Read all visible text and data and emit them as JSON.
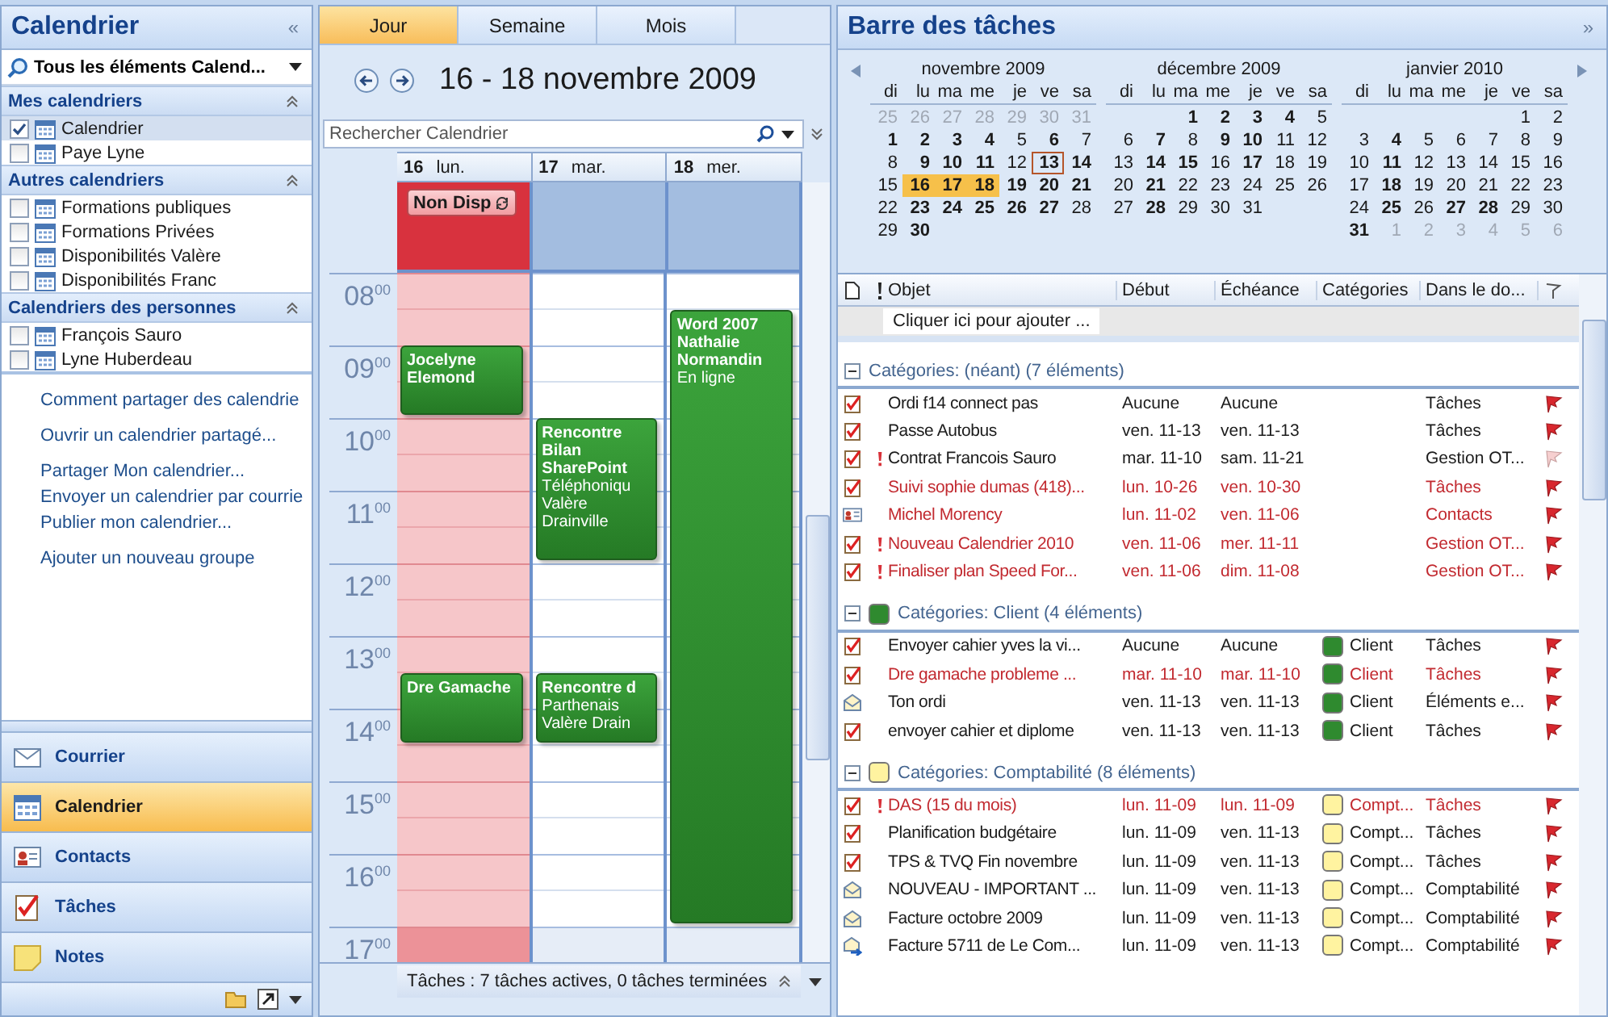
{
  "nav_pane": {
    "title": "Calendrier",
    "collapse": "«",
    "view_selector": "Tous les éléments Calend...",
    "groups": [
      {
        "title": "Mes calendriers",
        "items": [
          {
            "label": "Calendrier",
            "checked": true,
            "selected": true
          },
          {
            "label": "Paye Lyne",
            "checked": false,
            "selected": false
          }
        ]
      },
      {
        "title": "Autres calendriers",
        "items": [
          {
            "label": "Formations publiques",
            "checked": false,
            "selected": false
          },
          {
            "label": "Formations Privées",
            "checked": false,
            "selected": false
          },
          {
            "label": "Disponibilités Valère",
            "checked": false,
            "selected": false
          },
          {
            "label": "Disponibilités Franc",
            "checked": false,
            "selected": false
          }
        ]
      },
      {
        "title": "Calendriers des personnes",
        "items": [
          {
            "label": "François Sauro",
            "checked": false,
            "selected": false
          },
          {
            "label": "Lyne Huberdeau",
            "checked": false,
            "selected": false
          }
        ]
      }
    ],
    "link_groups": [
      [
        "Comment partager des calendrie"
      ],
      [
        "Ouvrir un calendrier partagé..."
      ],
      [
        "Partager Mon calendrier...",
        "Envoyer un calendrier par courrie",
        "Publier mon calendrier..."
      ],
      [
        "Ajouter un nouveau groupe"
      ]
    ],
    "buttons": [
      {
        "label": "Courrier",
        "kind": "mail",
        "selected": false
      },
      {
        "label": "Calendrier",
        "kind": "calendar",
        "selected": true
      },
      {
        "label": "Contacts",
        "kind": "contacts",
        "selected": false
      },
      {
        "label": "Tâches",
        "kind": "tasks",
        "selected": false
      },
      {
        "label": "Notes",
        "kind": "notes",
        "selected": false
      }
    ]
  },
  "calendar": {
    "tabs": [
      {
        "label": "Jour",
        "selected": true
      },
      {
        "label": "Semaine",
        "selected": false
      },
      {
        "label": "Mois",
        "selected": false
      }
    ],
    "date_range": "16 - 18 novembre 2009",
    "search": {
      "placeholder": "Rechercher Calendrier"
    },
    "hours": [
      {
        "h": "08",
        "m": "00"
      },
      {
        "h": "09",
        "m": "00"
      },
      {
        "h": "10",
        "m": "00"
      },
      {
        "h": "11",
        "m": "00"
      },
      {
        "h": "12",
        "m": "00"
      },
      {
        "h": "13",
        "m": "00"
      },
      {
        "h": "14",
        "m": "00"
      },
      {
        "h": "15",
        "m": "00"
      },
      {
        "h": "16",
        "m": "00"
      },
      {
        "h": "17",
        "m": "00"
      }
    ],
    "days": [
      {
        "number": "16",
        "weekday": "lun.",
        "unavailable": true,
        "all_day": [
          {
            "title": "Non Disp",
            "recurring": true
          }
        ],
        "events": [
          {
            "title": "Jocelyne Elemond"
          },
          {
            "title": "Dre Gamache"
          }
        ]
      },
      {
        "number": "17",
        "weekday": "mar.",
        "unavailable": false,
        "events": [
          {
            "title": "Rencontre Bilan SharePoint",
            "location": "Téléphoniqu Valère Drainville"
          },
          {
            "title": "Rencontre d",
            "location": "Parthenais Valère Drain"
          }
        ]
      },
      {
        "number": "18",
        "weekday": "mer.",
        "unavailable": false,
        "events": [
          {
            "title": "Word 2007 Nathalie Normandin",
            "location": "En ligne"
          }
        ]
      }
    ],
    "task_bar": "Tâches : 7 tâches actives, 0 tâches terminées"
  },
  "todo_bar": {
    "title": "Barre des tâches",
    "expand": "»",
    "months": [
      {
        "title": "novembre 2009",
        "weekdays": [
          "di",
          "lu",
          "ma",
          "me",
          "je",
          "ve",
          "sa"
        ],
        "weeks": [
          [
            {
              "n": "25",
              "kind": "muted",
              "selected": false
            },
            {
              "n": "26",
              "kind": "muted",
              "selected": false
            },
            {
              "n": "27",
              "kind": "muted",
              "selected": false
            },
            {
              "n": "28",
              "kind": "muted",
              "selected": false
            },
            {
              "n": "29",
              "kind": "muted",
              "selected": false
            },
            {
              "n": "30",
              "kind": "muted",
              "selected": false
            },
            {
              "n": "31",
              "kind": "muted",
              "selected": false
            }
          ],
          [
            {
              "n": "1",
              "kind": "bold",
              "selected": false
            },
            {
              "n": "2",
              "kind": "bold",
              "selected": false
            },
            {
              "n": "3",
              "kind": "bold",
              "selected": false
            },
            {
              "n": "4",
              "kind": "bold",
              "selected": false
            },
            {
              "n": "5",
              "kind": "plain",
              "selected": false
            },
            {
              "n": "6",
              "kind": "bold",
              "selected": false
            },
            {
              "n": "7",
              "kind": "plain",
              "selected": false
            }
          ],
          [
            {
              "n": "8",
              "kind": "plain",
              "selected": false
            },
            {
              "n": "9",
              "kind": "bold",
              "selected": false
            },
            {
              "n": "10",
              "kind": "bold",
              "selected": false
            },
            {
              "n": "11",
              "kind": "bold",
              "selected": false
            },
            {
              "n": "12",
              "kind": "plain",
              "selected": false
            },
            {
              "n": "13",
              "kind": "today",
              "selected": false
            },
            {
              "n": "14",
              "kind": "bold",
              "selected": false
            }
          ],
          [
            {
              "n": "15",
              "kind": "plain",
              "selected": false
            },
            {
              "n": "16",
              "kind": "bold",
              "selected": true
            },
            {
              "n": "17",
              "kind": "bold",
              "selected": true
            },
            {
              "n": "18",
              "kind": "bold",
              "selected": true
            },
            {
              "n": "19",
              "kind": "bold",
              "selected": false
            },
            {
              "n": "20",
              "kind": "bold",
              "selected": false
            },
            {
              "n": "21",
              "kind": "bold",
              "selected": false
            }
          ],
          [
            {
              "n": "22",
              "kind": "plain",
              "selected": false
            },
            {
              "n": "23",
              "kind": "bold",
              "selected": false
            },
            {
              "n": "24",
              "kind": "bold",
              "selected": false
            },
            {
              "n": "25",
              "kind": "bold",
              "selected": false
            },
            {
              "n": "26",
              "kind": "bold",
              "selected": false
            },
            {
              "n": "27",
              "kind": "bold",
              "selected": false
            },
            {
              "n": "28",
              "kind": "plain",
              "selected": false
            }
          ],
          [
            {
              "n": "29",
              "kind": "plain",
              "selected": false
            },
            {
              "n": "30",
              "kind": "bold",
              "selected": false
            },
            {
              "kind": "blank",
              "selected": false
            },
            {
              "kind": "blank",
              "selected": false
            },
            {
              "kind": "blank",
              "selected": false
            },
            {
              "kind": "blank",
              "selected": false
            },
            {
              "kind": "blank",
              "selected": false
            }
          ]
        ]
      },
      {
        "title": "décembre 2009",
        "weekdays": [
          "di",
          "lu",
          "ma",
          "me",
          "je",
          "ve",
          "sa"
        ],
        "weeks": [
          [
            {
              "kind": "blank",
              "selected": false
            },
            {
              "kind": "blank",
              "selected": false
            },
            {
              "n": "1",
              "kind": "bold",
              "selected": false
            },
            {
              "n": "2",
              "kind": "bold",
              "selected": false
            },
            {
              "n": "3",
              "kind": "bold",
              "selected": false
            },
            {
              "n": "4",
              "kind": "bold",
              "selected": false
            },
            {
              "n": "5",
              "kind": "plain",
              "selected": false
            }
          ],
          [
            {
              "n": "6",
              "kind": "plain",
              "selected": false
            },
            {
              "n": "7",
              "kind": "bold",
              "selected": false
            },
            {
              "n": "8",
              "kind": "plain",
              "selected": false
            },
            {
              "n": "9",
              "kind": "bold",
              "selected": false
            },
            {
              "n": "10",
              "kind": "bold",
              "selected": false
            },
            {
              "n": "11",
              "kind": "plain",
              "selected": false
            },
            {
              "n": "12",
              "kind": "plain",
              "selected": false
            }
          ],
          [
            {
              "n": "13",
              "kind": "plain",
              "selected": false
            },
            {
              "n": "14",
              "kind": "bold",
              "selected": false
            },
            {
              "n": "15",
              "kind": "bold",
              "selected": false
            },
            {
              "n": "16",
              "kind": "plain",
              "selected": false
            },
            {
              "n": "17",
              "kind": "bold",
              "selected": false
            },
            {
              "n": "18",
              "kind": "plain",
              "selected": false
            },
            {
              "n": "19",
              "kind": "plain",
              "selected": false
            }
          ],
          [
            {
              "n": "20",
              "kind": "plain",
              "selected": false
            },
            {
              "n": "21",
              "kind": "bold",
              "selected": false
            },
            {
              "n": "22",
              "kind": "plain",
              "selected": false
            },
            {
              "n": "23",
              "kind": "plain",
              "selected": false
            },
            {
              "n": "24",
              "kind": "plain",
              "selected": false
            },
            {
              "n": "25",
              "kind": "plain",
              "selected": false
            },
            {
              "n": "26",
              "kind": "plain",
              "selected": false
            }
          ],
          [
            {
              "n": "27",
              "kind": "plain",
              "selected": false
            },
            {
              "n": "28",
              "kind": "bold",
              "selected": false
            },
            {
              "n": "29",
              "kind": "plain",
              "selected": false
            },
            {
              "n": "30",
              "kind": "plain",
              "selected": false
            },
            {
              "n": "31",
              "kind": "plain",
              "selected": false
            },
            {
              "kind": "blank",
              "selected": false
            },
            {
              "kind": "blank",
              "selected": false
            }
          ]
        ]
      },
      {
        "title": "janvier 2010",
        "weekdays": [
          "di",
          "lu",
          "ma",
          "me",
          "je",
          "ve",
          "sa"
        ],
        "weeks": [
          [
            {
              "kind": "blank",
              "selected": false
            },
            {
              "kind": "blank",
              "selected": false
            },
            {
              "kind": "blank",
              "selected": false
            },
            {
              "kind": "blank",
              "selected": false
            },
            {
              "kind": "blank",
              "selected": false
            },
            {
              "n": "1",
              "kind": "plain",
              "selected": false
            },
            {
              "n": "2",
              "kind": "plain",
              "selected": false
            }
          ],
          [
            {
              "n": "3",
              "kind": "plain",
              "selected": false
            },
            {
              "n": "4",
              "kind": "bold",
              "selected": false
            },
            {
              "n": "5",
              "kind": "plain",
              "selected": false
            },
            {
              "n": "6",
              "kind": "plain",
              "selected": false
            },
            {
              "n": "7",
              "kind": "plain",
              "selected": false
            },
            {
              "n": "8",
              "kind": "plain",
              "selected": false
            },
            {
              "n": "9",
              "kind": "plain",
              "selected": false
            }
          ],
          [
            {
              "n": "10",
              "kind": "plain",
              "selected": false
            },
            {
              "n": "11",
              "kind": "bold",
              "selected": false
            },
            {
              "n": "12",
              "kind": "plain",
              "selected": false
            },
            {
              "n": "13",
              "kind": "plain",
              "selected": false
            },
            {
              "n": "14",
              "kind": "plain",
              "selected": false
            },
            {
              "n": "15",
              "kind": "plain",
              "selected": false
            },
            {
              "n": "16",
              "kind": "plain",
              "selected": false
            }
          ],
          [
            {
              "n": "17",
              "kind": "plain",
              "selected": false
            },
            {
              "n": "18",
              "kind": "bold",
              "selected": false
            },
            {
              "n": "19",
              "kind": "plain",
              "selected": false
            },
            {
              "n": "20",
              "kind": "plain",
              "selected": false
            },
            {
              "n": "21",
              "kind": "plain",
              "selected": false
            },
            {
              "n": "22",
              "kind": "plain",
              "selected": false
            },
            {
              "n": "23",
              "kind": "plain",
              "selected": false
            }
          ],
          [
            {
              "n": "24",
              "kind": "plain",
              "selected": false
            },
            {
              "n": "25",
              "kind": "bold",
              "selected": false
            },
            {
              "n": "26",
              "kind": "plain",
              "selected": false
            },
            {
              "n": "27",
              "kind": "bold",
              "selected": false
            },
            {
              "n": "28",
              "kind": "bold",
              "selected": false
            },
            {
              "n": "29",
              "kind": "plain",
              "selected": false
            },
            {
              "n": "30",
              "kind": "plain",
              "selected": false
            }
          ],
          [
            {
              "n": "31",
              "kind": "bold",
              "selected": false
            },
            {
              "n": "1",
              "kind": "muted",
              "selected": false
            },
            {
              "n": "2",
              "kind": "muted",
              "selected": false
            },
            {
              "n": "3",
              "kind": "muted",
              "selected": false
            },
            {
              "n": "4",
              "kind": "muted",
              "selected": false
            },
            {
              "n": "5",
              "kind": "muted",
              "selected": false
            },
            {
              "n": "6",
              "kind": "muted",
              "selected": false
            }
          ]
        ]
      }
    ],
    "tasks": {
      "columns": [
        "Objet",
        "Début",
        "Échéance",
        "Catégories",
        "Dans le do..."
      ],
      "new_item": "Cliquer ici pour ajouter ...",
      "groups": [
        {
          "title": "Catégories: (néant) (7 éléments)",
          "rows": [
            {
              "kind": "task",
              "important": false,
              "overdue": false,
              "subject": "Ordi f14 connect pas",
              "start": "Aucune",
              "due": "Aucune",
              "folder": "Tâches",
              "flag_dim": false
            },
            {
              "kind": "task",
              "important": false,
              "overdue": false,
              "subject": "Passe Autobus",
              "start": "ven. 11-13",
              "due": "ven. 11-13",
              "folder": "Tâches",
              "flag_dim": false
            },
            {
              "kind": "task",
              "important": true,
              "overdue": false,
              "subject": "Contrat Francois Sauro",
              "start": "mar. 11-10",
              "due": "sam. 11-21",
              "folder": "Gestion OT...",
              "flag_dim": true
            },
            {
              "kind": "task",
              "important": false,
              "overdue": true,
              "subject": "Suivi sophie dumas (418)...",
              "start": "lun. 10-26",
              "due": "ven. 10-30",
              "folder": "Tâches",
              "flag_dim": false
            },
            {
              "kind": "contact",
              "important": false,
              "overdue": true,
              "subject": "Michel Morency",
              "start": "lun. 11-02",
              "due": "ven. 11-06",
              "folder": "Contacts",
              "flag_dim": false
            },
            {
              "kind": "task",
              "important": true,
              "overdue": true,
              "subject": "Nouveau Calendrier 2010",
              "start": "ven. 11-06",
              "due": "mer. 11-11",
              "folder": "Gestion OT...",
              "flag_dim": false
            },
            {
              "kind": "task",
              "important": true,
              "overdue": true,
              "subject": "Finaliser plan Speed For...",
              "start": "ven. 11-06",
              "due": "dim. 11-08",
              "folder": "Gestion OT...",
              "flag_dim": false
            }
          ]
        },
        {
          "title": "Catégories: Client (4 éléments)",
          "color": "#2f8a2f",
          "rows": [
            {
              "kind": "task",
              "important": false,
              "overdue": false,
              "subject": "Envoyer cahier yves la vi...",
              "start": "Aucune",
              "due": "Aucune",
              "category": "Client",
              "folder": "Tâches",
              "flag_dim": false
            },
            {
              "kind": "task",
              "important": false,
              "overdue": true,
              "subject": "Dre gamache probleme ...",
              "start": "mar. 11-10",
              "due": "mar. 11-10",
              "category": "Client",
              "folder": "Tâches",
              "flag_dim": false
            },
            {
              "kind": "mail",
              "important": false,
              "overdue": false,
              "subject": "Ton ordi",
              "start": "ven. 11-13",
              "due": "ven. 11-13",
              "category": "Client",
              "folder": "Éléments e...",
              "flag_dim": false
            },
            {
              "kind": "task",
              "important": false,
              "overdue": false,
              "subject": "envoyer cahier et diplome",
              "start": "ven. 11-13",
              "due": "ven. 11-13",
              "category": "Client",
              "folder": "Tâches",
              "flag_dim": false
            }
          ]
        },
        {
          "title": "Catégories: Comptabilité (8 éléments)",
          "color": "#fff3a0",
          "rows": [
            {
              "kind": "task",
              "important": true,
              "overdue": true,
              "subject": "DAS (15 du mois)",
              "start": "lun. 11-09",
              "due": "lun. 11-09",
              "category": "Compt...",
              "folder": "Tâches",
              "flag_dim": false
            },
            {
              "kind": "task",
              "important": false,
              "overdue": false,
              "subject": "Planification budgétaire",
              "start": "lun. 11-09",
              "due": "ven. 11-13",
              "category": "Compt...",
              "folder": "Tâches",
              "flag_dim": false
            },
            {
              "kind": "task",
              "important": false,
              "overdue": false,
              "subject": "TPS & TVQ Fin novembre",
              "start": "lun. 11-09",
              "due": "ven. 11-13",
              "category": "Compt...",
              "folder": "Tâches",
              "flag_dim": false
            },
            {
              "kind": "mail",
              "important": false,
              "overdue": false,
              "subject": "NOUVEAU - IMPORTANT ...",
              "start": "lun. 11-09",
              "due": "ven. 11-13",
              "category": "Compt...",
              "folder": "Comptabilité",
              "flag_dim": false
            },
            {
              "kind": "mail",
              "important": false,
              "overdue": false,
              "subject": "Facture octobre 2009",
              "start": "lun. 11-09",
              "due": "ven. 11-13",
              "category": "Compt...",
              "folder": "Comptabilité",
              "flag_dim": false
            },
            {
              "kind": "forward",
              "important": false,
              "overdue": false,
              "subject": "Facture 5711 de Le Com...",
              "start": "lun. 11-09",
              "due": "ven. 11-13",
              "category": "Compt...",
              "folder": "Comptabilité",
              "flag_dim": false
            }
          ]
        }
      ]
    }
  }
}
